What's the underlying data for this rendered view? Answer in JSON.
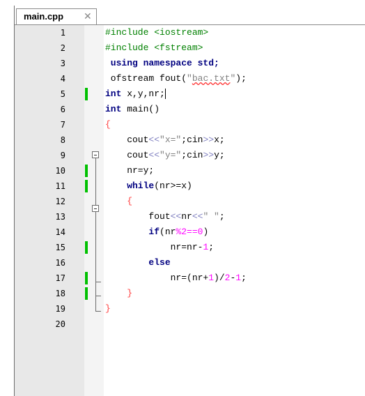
{
  "tab": {
    "label": "main.cpp",
    "close": "✕"
  },
  "lines": [
    {
      "n": "1"
    },
    {
      "n": "2"
    },
    {
      "n": "3"
    },
    {
      "n": "4"
    },
    {
      "n": "5"
    },
    {
      "n": "6"
    },
    {
      "n": "7"
    },
    {
      "n": "8"
    },
    {
      "n": "9"
    },
    {
      "n": "10"
    },
    {
      "n": "11"
    },
    {
      "n": "12"
    },
    {
      "n": "13"
    },
    {
      "n": "14"
    },
    {
      "n": "15"
    },
    {
      "n": "16"
    },
    {
      "n": "17"
    },
    {
      "n": "18"
    },
    {
      "n": "19"
    },
    {
      "n": "20"
    }
  ],
  "code": {
    "l1_pre": "#include ",
    "l1_inc": "<iostream>",
    "l2_pre": "#include ",
    "l2_inc": "<fstream>",
    "l3_kw": " using namespace std;",
    "l4_a": " ofstream fout",
    "l4_b": "(",
    "l4_c": "\"",
    "l4_d": "bac.txt",
    "l4_e": "\"",
    "l4_f": ");",
    "l5_kw": "int",
    "l5_rest": " x,y,nr;",
    "l6_kw": "int",
    "l6_rest": " main()",
    "l7": "{",
    "l8_a": "    cout",
    "l8_b": "<<",
    "l8_c": "\"x=\"",
    "l8_d": ";",
    "l8_e": "cin",
    "l8_f": ">>",
    "l8_g": "x;",
    "l9_a": "    cout",
    "l9_b": "<<",
    "l9_c": "\"y=\"",
    "l9_d": ";",
    "l9_e": "cin",
    "l9_f": ">>",
    "l9_g": "y;",
    "l10": "    nr=y;",
    "l11_kw": "    while",
    "l11_rest": "(nr>=x)",
    "l12": "    {",
    "l13_a": "        fout",
    "l13_b": "<<",
    "l13_c": "nr",
    "l13_d": "<<",
    "l13_e": "\" \"",
    "l13_f": ";",
    "l14_kw": "        if",
    "l14_a": "(nr",
    "l14_b": "%",
    "l14_c": "2",
    "l14_d": "==",
    "l14_e": "0",
    "l14_f": ")",
    "l15_a": "            nr=nr-",
    "l15_b": "1",
    "l15_c": ";",
    "l16_kw": "        else",
    "l17_a": "            nr=(nr+",
    "l17_b": "1",
    "l17_c": ")/",
    "l17_d": "2",
    "l17_e": "-",
    "l17_f": "1",
    "l17_g": ";",
    "l18": "    }",
    "l19": "}"
  },
  "changed_lines": [
    "5",
    "10",
    "11",
    "15",
    "17",
    "18"
  ],
  "colors": {
    "keyword": "#000080",
    "preprocessor": "#008000",
    "operator": "#8080c0",
    "string": "#808080",
    "number": "#ff00ff",
    "brace": "#ff4040",
    "change_marker": "#00c000"
  }
}
